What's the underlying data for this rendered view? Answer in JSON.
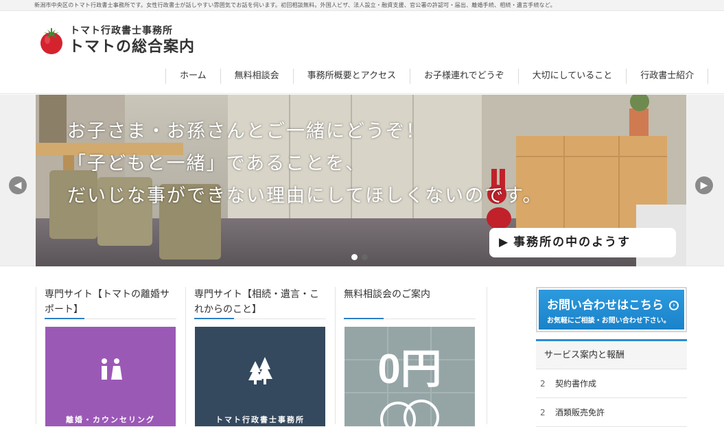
{
  "topbar": {
    "text": "新潟市中央区のトマト行政書士事務所です。女性行政書士が話しやすい雰囲気でお話を伺います。初回相談無料。外国人ビザ、法人設立・融資支援、官公署の許認可・届出、離婚手続、相続・遺言手続など。"
  },
  "logo": {
    "sub": "トマト行政書士事務所",
    "main": "トマトの総合案内"
  },
  "nav": {
    "items": [
      "ホーム",
      "無料相談会",
      "事務所概要とアクセス",
      "お子様連れでどうぞ",
      "大切にしていること",
      "行政書士紹介"
    ]
  },
  "slider": {
    "caption_lines": [
      "お子さま・お孫さんとご一緒にどうぞ！",
      "「子どもと一緒」であることを、",
      "だいじな事ができない理由にしてほしくないのです。"
    ],
    "button_label": "事務所の中のようす",
    "arrow_left": "◀",
    "arrow_right": "▶",
    "slide_count": 2,
    "active_slide": 1
  },
  "cards": [
    {
      "title": "専門サイト【トマトの離婚サポート】",
      "image_label": "離婚・カウンセリング",
      "image_color": "#9b59b6"
    },
    {
      "title": "専門サイト【相続・遺言・これからのこと】",
      "image_label": "トマト行政書士事務所",
      "image_color": "#34495e"
    },
    {
      "title": "無料相談会のご案内",
      "image_label": "",
      "image_text": "0円",
      "image_color": "#95a5a6"
    }
  ],
  "sidebar": {
    "contact_title": "お問い合わせはこちら",
    "contact_sub": "お気軽にご相談・お問い合わせ下さい。",
    "menu_head": "サービス案内と報酬",
    "menu_items": [
      {
        "bullet": "2",
        "label": "契約書作成"
      },
      {
        "bullet": "2",
        "label": "酒類販売免許"
      }
    ]
  },
  "colors": {
    "accent_blue": "#2b8ad6",
    "contact_blue": "#1f8bd3",
    "purple": "#9b59b6",
    "navy": "#34495e",
    "gray": "#95a5a6"
  }
}
